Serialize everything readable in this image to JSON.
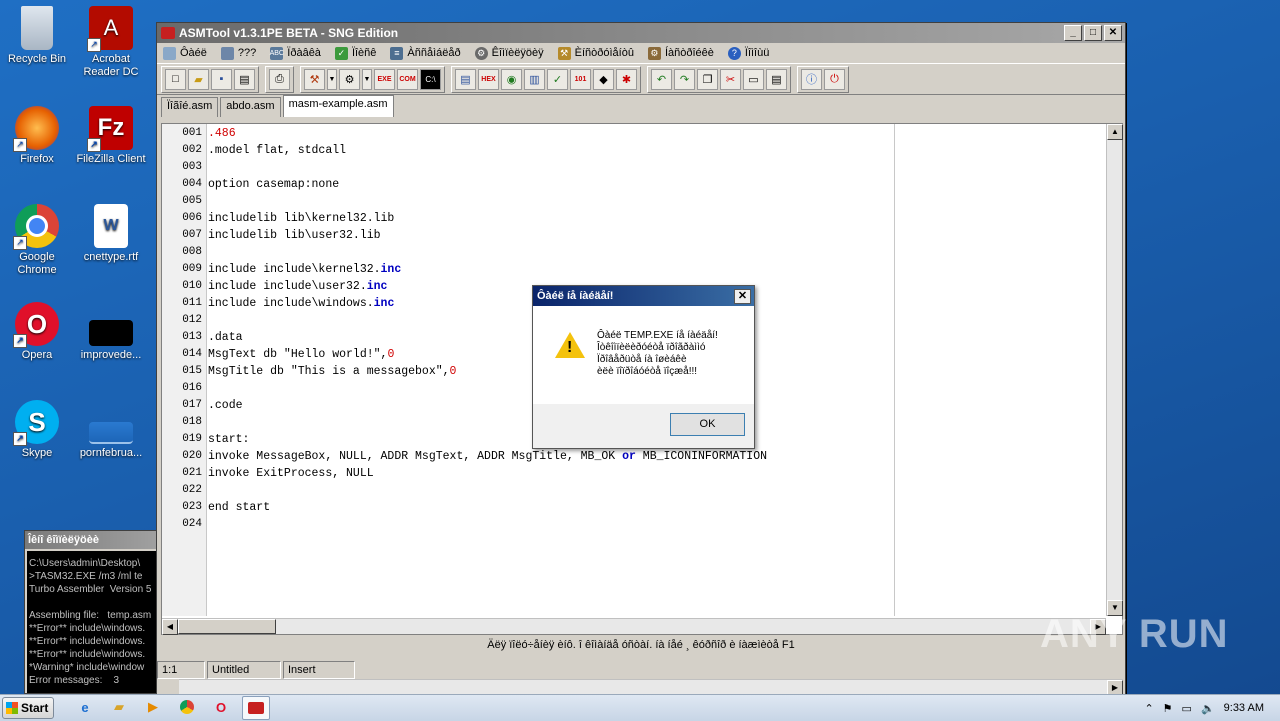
{
  "desktop_icons": [
    {
      "label": "Recycle Bin",
      "icon": "recycle-bin-icon"
    },
    {
      "label": "Acrobat Reader DC",
      "icon": "acrobat-icon"
    },
    {
      "label": "Firefox",
      "icon": "firefox-icon"
    },
    {
      "label": "FileZilla Client",
      "icon": "filezilla-icon"
    },
    {
      "label": "Google Chrome",
      "icon": "chrome-icon"
    },
    {
      "label": "cnettype.rtf",
      "icon": "word-doc-icon"
    },
    {
      "label": "Opera",
      "icon": "opera-icon"
    },
    {
      "label": "improvede...",
      "icon": "black-file-icon"
    },
    {
      "label": "Skype",
      "icon": "skype-icon"
    },
    {
      "label": "pornfebrua...",
      "icon": "file-icon"
    }
  ],
  "window": {
    "title": "ASMTool v1.3.1PE BETA - SNG Edition",
    "menu": [
      "Ôàéë",
      "???",
      "Ïðàâêà",
      "Ïîèñê",
      "Àññåìáëåð",
      "Êîìïèëÿöèÿ",
      "Èíñòðóìåíòû",
      "Íàñòðîéêè",
      "Ïîìîùü"
    ],
    "tabs": [
      "Ïîãîé.asm",
      "abdo.asm",
      "masm-example.asm"
    ],
    "active_tab": "masm-example.asm",
    "code_lines": [
      {
        "n": "001",
        "text": ".486",
        "cls": "num"
      },
      {
        "n": "002",
        "text": ".model flat, stdcall"
      },
      {
        "n": "003",
        "text": ""
      },
      {
        "n": "004",
        "text": "option casemap:none"
      },
      {
        "n": "005",
        "text": ""
      },
      {
        "n": "006",
        "text": "includelib lib\\kernel32.lib"
      },
      {
        "n": "007",
        "text": "includelib lib\\user32.lib"
      },
      {
        "n": "008",
        "text": ""
      },
      {
        "n": "009",
        "text": "include include\\kernel32.",
        "kw": "inc"
      },
      {
        "n": "010",
        "text": "include include\\user32.",
        "kw": "inc"
      },
      {
        "n": "011",
        "text": "include include\\windows.",
        "kw": "inc"
      },
      {
        "n": "012",
        "text": ""
      },
      {
        "n": "013",
        "text": ".data"
      },
      {
        "n": "014",
        "text": "MsgText db \"Hello world!\",",
        "tail_num": "0"
      },
      {
        "n": "015",
        "text": "MsgTitle db \"This is a messagebox\",",
        "tail_num": "0"
      },
      {
        "n": "016",
        "text": ""
      },
      {
        "n": "017",
        "text": ".code"
      },
      {
        "n": "018",
        "text": ""
      },
      {
        "n": "019",
        "text": "start:"
      },
      {
        "n": "020",
        "text": "invoke MessageBox, NULL, ADDR MsgText, ADDR MsgTitle, MB_OK ",
        "kw": "or",
        "tail": " MB_ICONINFORMATION"
      },
      {
        "n": "021",
        "text": "invoke ExitProcess, NULL"
      },
      {
        "n": "022",
        "text": ""
      },
      {
        "n": "023",
        "text": "end start"
      },
      {
        "n": "024",
        "text": ""
      }
    ],
    "hint": "Äëÿ ïîëó÷åíèÿ èíô. î êîìàíäå óñòàí. íà íåé ¸ êóðñîð è íàæìèòå F1",
    "status": {
      "pos": "1:1",
      "file": "Untitled",
      "mode": "Insert"
    }
  },
  "dialog": {
    "title": "Ôàéë íå íàéäåí!",
    "lines": [
      "Ôàéë TEMP.EXE íå íàéäåí!",
      "Îòêîìïèëèðóéòå ïðîãðàììó",
      "Ïðîâåðüòå íà îøèáêè",
      "èëè ïîïðîáóéòå ïîçæå!!!"
    ],
    "ok": "OK"
  },
  "console": {
    "title": "Îêíî êîìïèëÿöèè",
    "lines": [
      "C:\\Users\\admin\\Desktop\\",
      ">TASM32.EXE /m3 /ml te",
      "Turbo Assembler  Version 5",
      "",
      "Assembling file:   temp.asm",
      "**Error** include\\windows.",
      "**Error** include\\windows.",
      "**Error** include\\windows.",
      "*Warning* include\\window",
      "Error messages:    3"
    ]
  },
  "taskbar": {
    "start": "Start",
    "clock": "9:33 AM"
  },
  "watermark": "ANY RUN"
}
